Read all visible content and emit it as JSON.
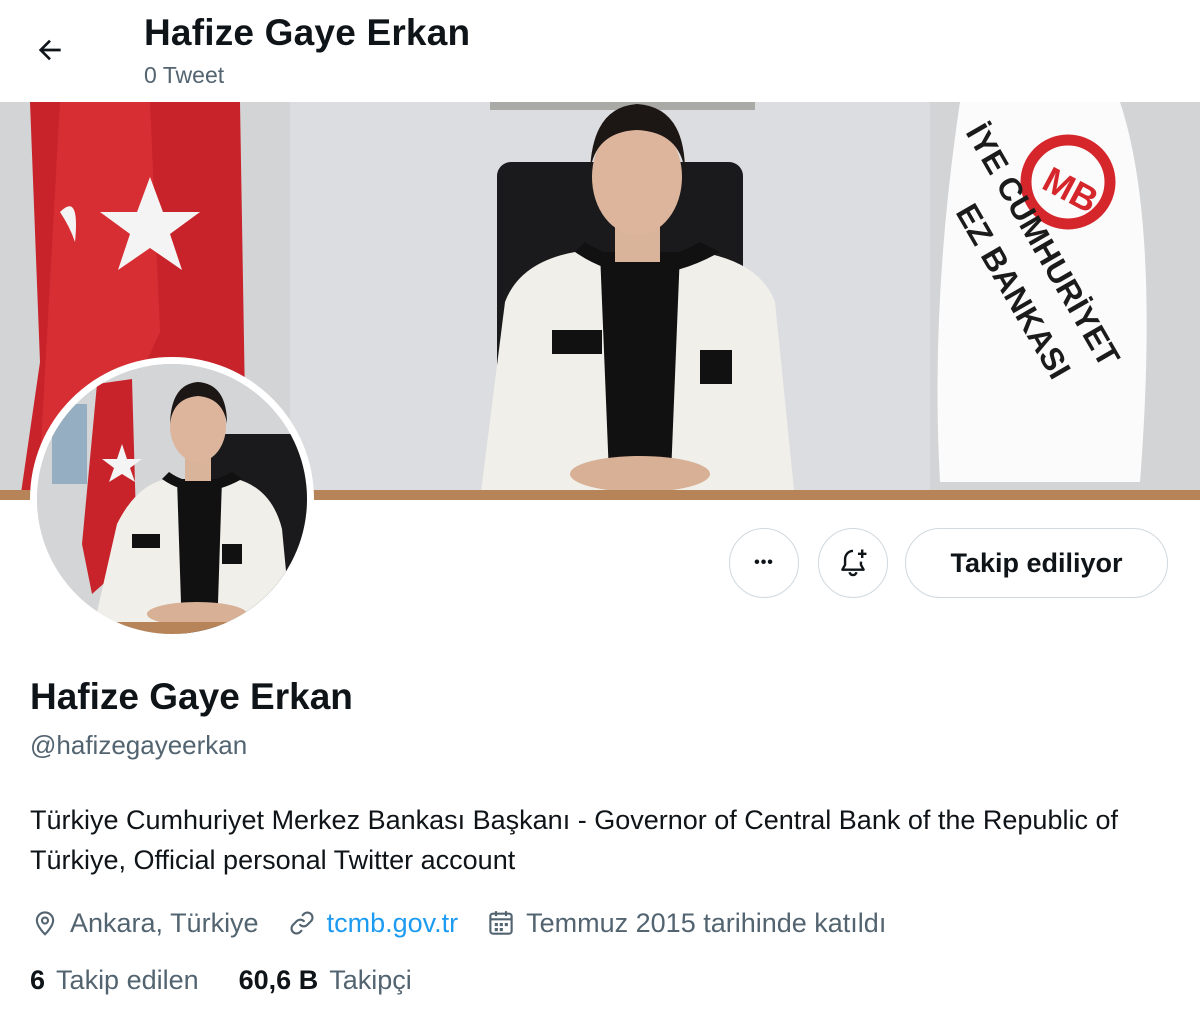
{
  "header": {
    "title": "Hafize Gaye Erkan",
    "tweet_count": "0 Tweet"
  },
  "banner": {
    "flag_text_line1": "İYE CUMHURİYET",
    "flag_text_line2": "EZ BANKASI",
    "logo_text": "MB"
  },
  "actions": {
    "more_label": "•••",
    "follow_label": "Takip ediliyor"
  },
  "profile": {
    "name": "Hafize Gaye Erkan",
    "handle": "@hafizegayeerkan",
    "bio": "Türkiye Cumhuriyet Merkez Bankası Başkanı - Governor of Central Bank of the Republic of Türkiye, Official personal Twitter account",
    "location": "Ankara, Türkiye",
    "website": "tcmb.gov.tr",
    "joined": "Temmuz 2015 tarihinde katıldı"
  },
  "stats": {
    "following_count": "6",
    "following_label": "Takip edilen",
    "followers_count": "60,6 B",
    "followers_label": "Takipçi"
  },
  "icons": [
    "back-arrow-icon",
    "more-icon",
    "notification-bell-plus-icon",
    "location-icon",
    "link-icon",
    "calendar-icon"
  ],
  "colors": {
    "accent": "#1d9bf0",
    "muted": "#536471",
    "text": "#0f1419",
    "flag_red": "#d7262b"
  }
}
